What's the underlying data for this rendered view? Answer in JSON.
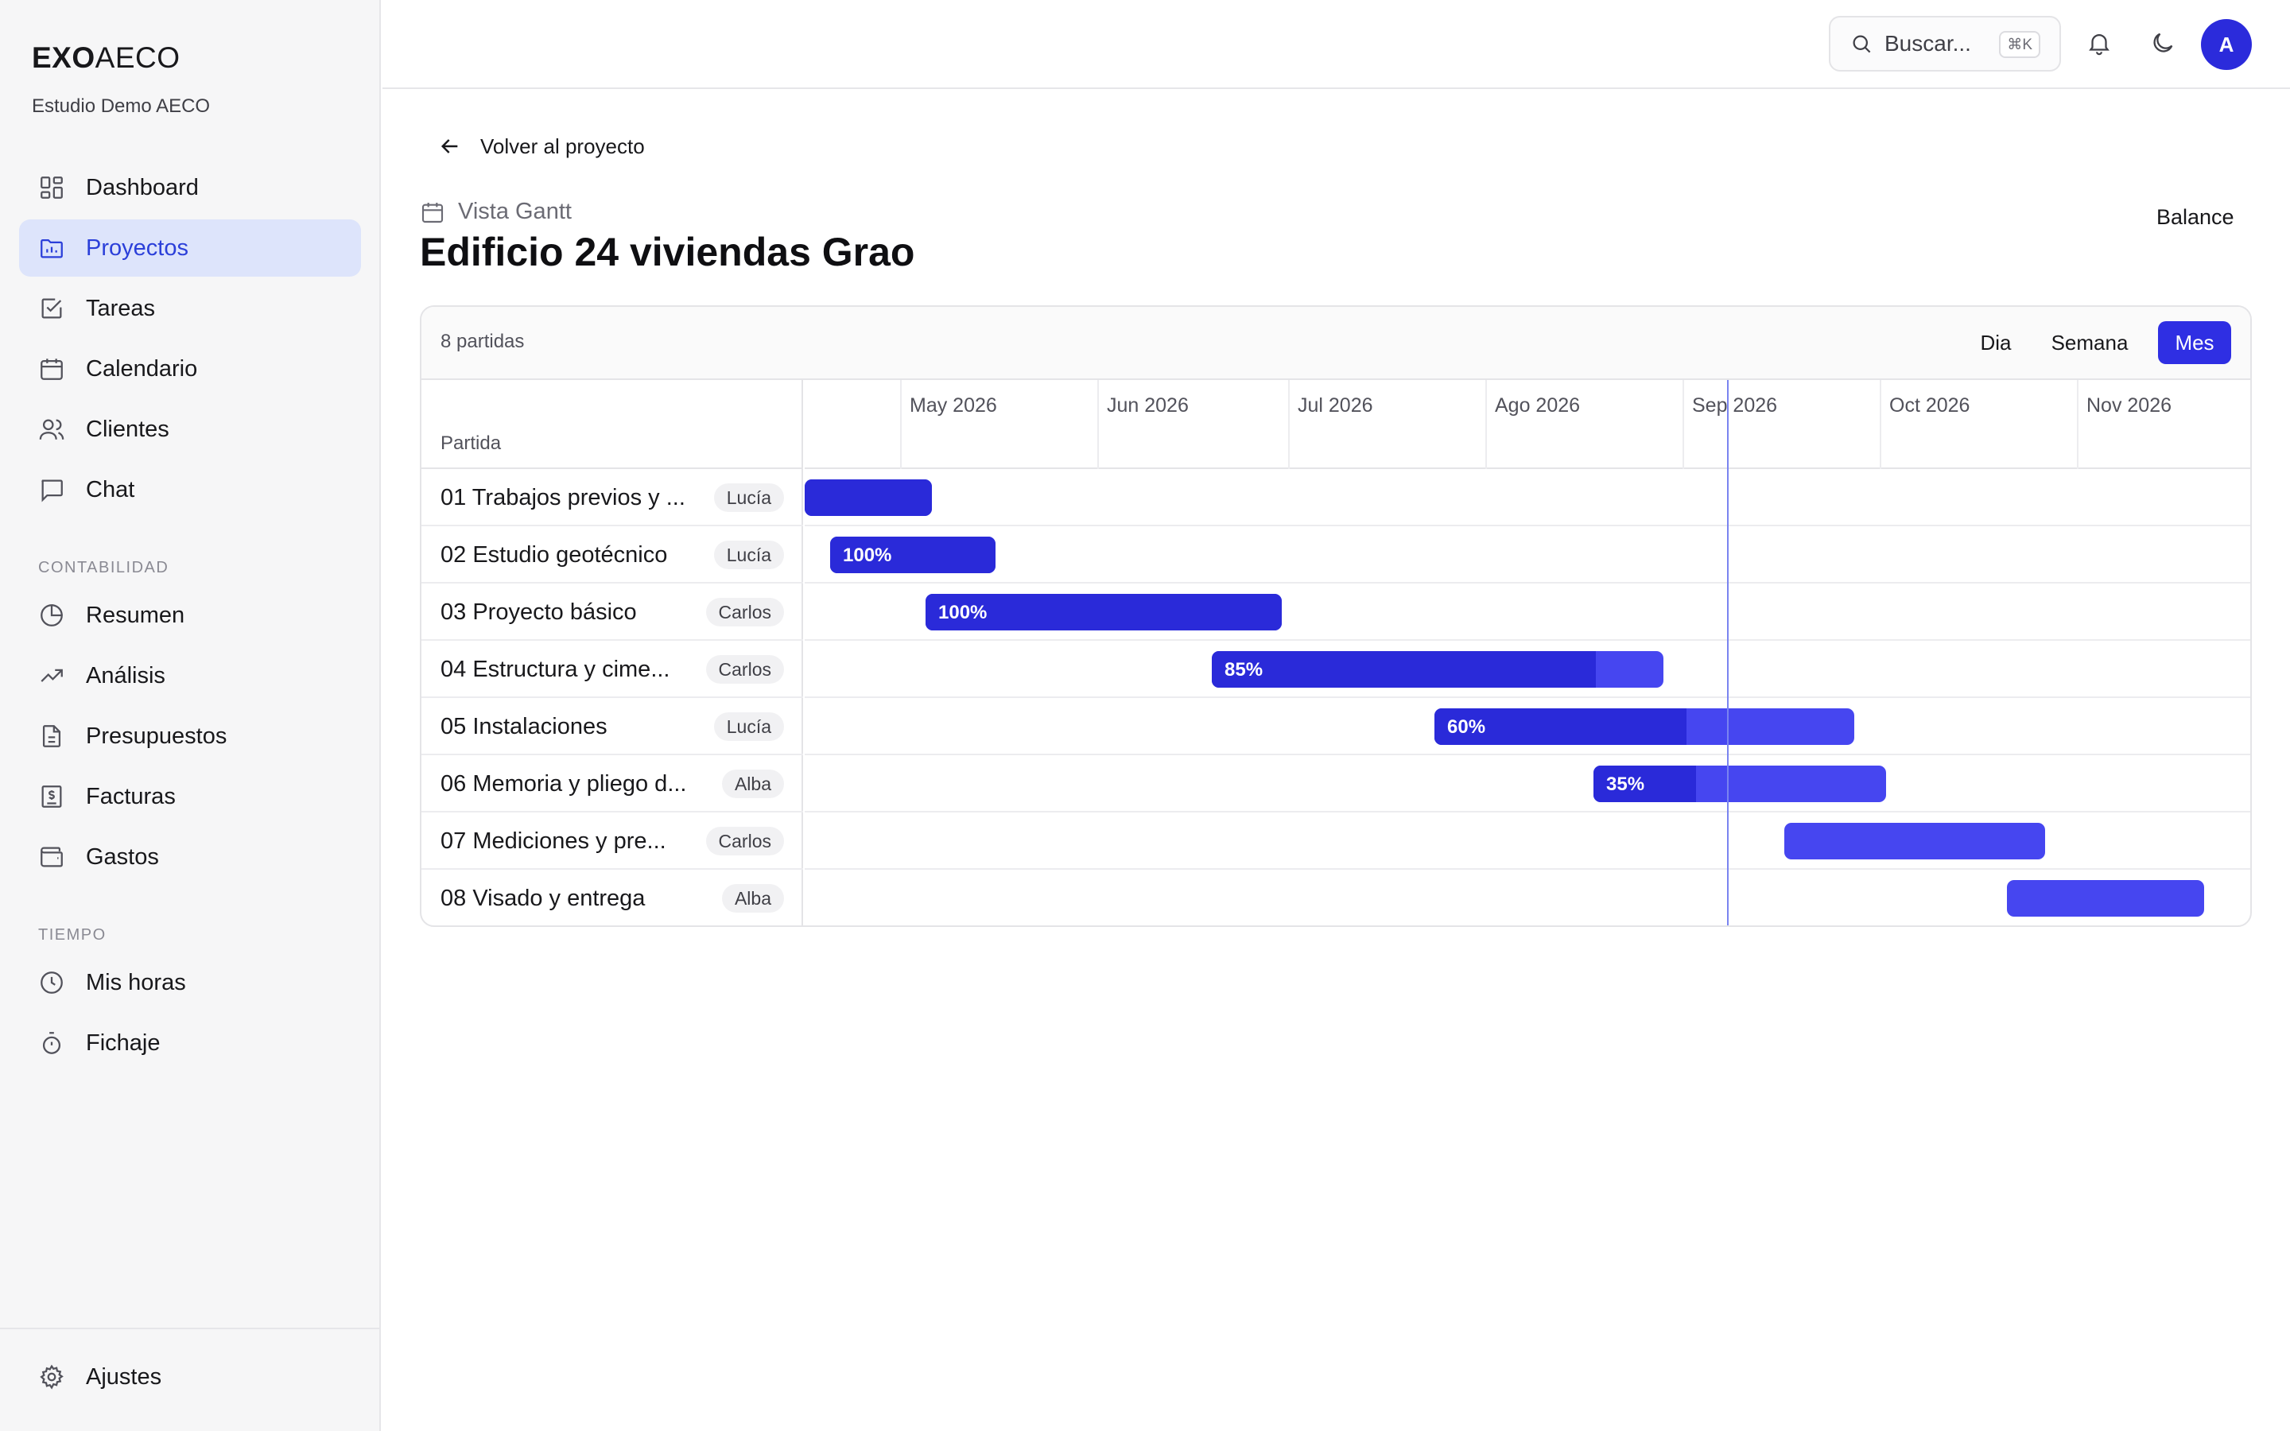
{
  "brand": {
    "bold": "EXO",
    "light": "AECO"
  },
  "org": "Estudio Demo AECO",
  "nav": {
    "main": [
      "Dashboard",
      "Proyectos",
      "Tareas",
      "Calendario",
      "Clientes",
      "Chat"
    ],
    "contabilidad_label": "CONTABILIDAD",
    "contabilidad": [
      "Resumen",
      "Análisis",
      "Presupuestos",
      "Facturas",
      "Gastos"
    ],
    "tiempo_label": "TIEMPO",
    "tiempo": [
      "Mis horas",
      "Fichaje"
    ],
    "settings": "Ajustes",
    "active": "Proyectos"
  },
  "header": {
    "search_placeholder": "Buscar...",
    "search_shortcut": "⌘K",
    "avatar_initial": "A"
  },
  "page": {
    "back_label": "Volver al proyecto",
    "subtitle": "Vista Gantt",
    "title": "Edificio 24 viviendas Grao",
    "balance_label": "Balance"
  },
  "gantt": {
    "count_label": "8 partidas",
    "views": [
      "Dia",
      "Semana",
      "Mes"
    ],
    "active_view": "Mes",
    "column_header": "Partida",
    "months": [
      "May 2026",
      "Jun 2026",
      "Jul 2026",
      "Ago 2026",
      "Sep 2026",
      "Oct 2026",
      "Nov 2026"
    ],
    "rows": [
      {
        "name": "01 Trabajos previos y ...",
        "assignee": "Lucía",
        "progress": 100,
        "progress_label": ""
      },
      {
        "name": "02 Estudio geotécnico",
        "assignee": "Lucía",
        "progress": 100,
        "progress_label": "100%"
      },
      {
        "name": "03 Proyecto básico",
        "assignee": "Carlos",
        "progress": 100,
        "progress_label": "100%"
      },
      {
        "name": "04 Estructura y cime...",
        "assignee": "Carlos",
        "progress": 85,
        "progress_label": "85%"
      },
      {
        "name": "05 Instalaciones",
        "assignee": "Lucía",
        "progress": 60,
        "progress_label": "60%"
      },
      {
        "name": "06 Memoria y pliego d...",
        "assignee": "Alba",
        "progress": 35,
        "progress_label": "35%"
      },
      {
        "name": "07 Mediciones y pre...",
        "assignee": "Carlos",
        "progress": 0,
        "progress_label": ""
      },
      {
        "name": "08 Visado y entrega",
        "assignee": "Alba",
        "progress": 0,
        "progress_label": ""
      }
    ]
  },
  "colors": {
    "accent": "#2f2fe3",
    "bar": "#4646f0",
    "bar_done": "#2a2ad9",
    "active_nav_bg": "#dde4fb"
  }
}
